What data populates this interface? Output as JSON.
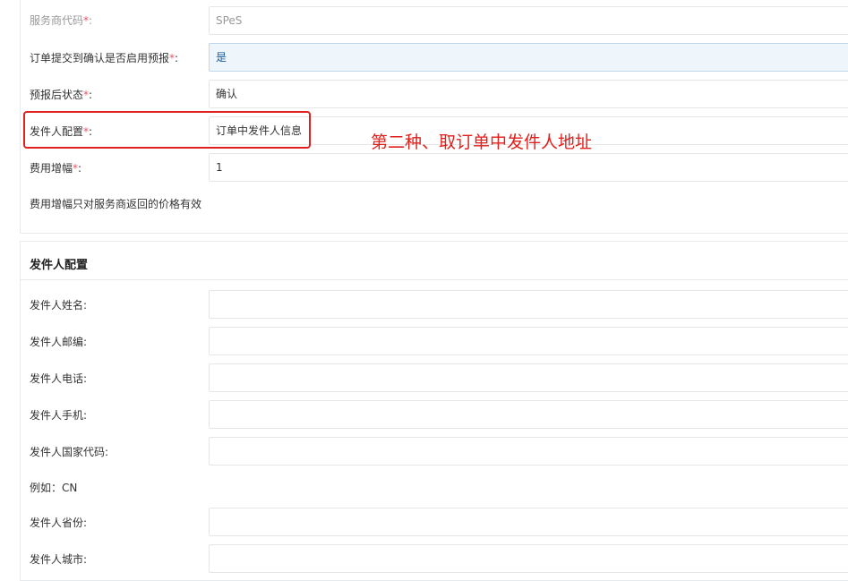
{
  "general": {
    "rows": [
      {
        "label": "服务商代码",
        "required": "*",
        "colon": ":",
        "value": "SPeS"
      },
      {
        "label": "订单提交到确认是否启用预报",
        "required": "*",
        "colon": ":",
        "value": "是"
      },
      {
        "label": "预报后状态",
        "required": "*",
        "colon": ":",
        "value": "确认"
      },
      {
        "label": "发件人配置",
        "required": "*",
        "colon": ":",
        "value": "订单中发件人信息"
      },
      {
        "label": "费用增幅",
        "required": "*",
        "colon": ":",
        "value": "1"
      }
    ],
    "hint": "费用增幅只对服务商返回的价格有效"
  },
  "annotation": {
    "text": "第二种、取订单中发件人地址",
    "color": "#e0201c"
  },
  "sender": {
    "title": "发件人配置",
    "fields": [
      {
        "label": "发件人姓名:",
        "value": ""
      },
      {
        "label": "发件人邮编:",
        "value": ""
      },
      {
        "label": "发件人电话:",
        "value": ""
      },
      {
        "label": "发件人手机:",
        "value": ""
      },
      {
        "label": "发件人国家代码:",
        "value": ""
      },
      {
        "label": "发件人省份:",
        "value": ""
      },
      {
        "label": "发件人城市:",
        "value": ""
      }
    ],
    "example": "例如：CN"
  },
  "colors": {
    "required": "#ed5565",
    "focused_bg": "#eef5fb",
    "border": "#e5e6e7"
  }
}
